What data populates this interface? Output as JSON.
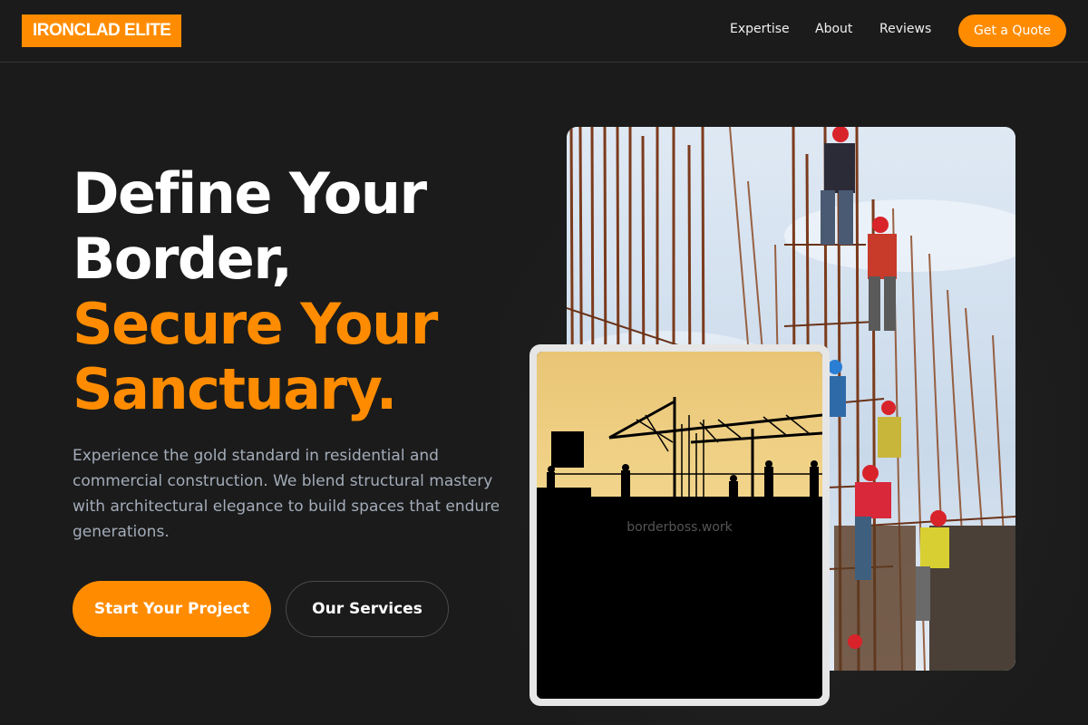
{
  "brand": {
    "name": "IRONCLAD ELITE"
  },
  "nav": {
    "links": [
      "Expertise",
      "About",
      "Reviews"
    ],
    "cta": "Get a Quote"
  },
  "hero": {
    "headline_lines": [
      "Define Your",
      "Border,"
    ],
    "accent_lines": [
      "Secure Your",
      "Sanctuary."
    ],
    "lead": "Experience the gold standard in residential and commercial construction. We blend structural mastery with architectural elegance to build spaces that endure for generations.",
    "primary_button": "Start Your Project",
    "secondary_button": "Our Services"
  },
  "gallery": {
    "watermark": "borderboss.work"
  },
  "colors": {
    "accent": "#ff8c00",
    "background": "#1b1b1b",
    "muted_text": "#a3acb9"
  }
}
